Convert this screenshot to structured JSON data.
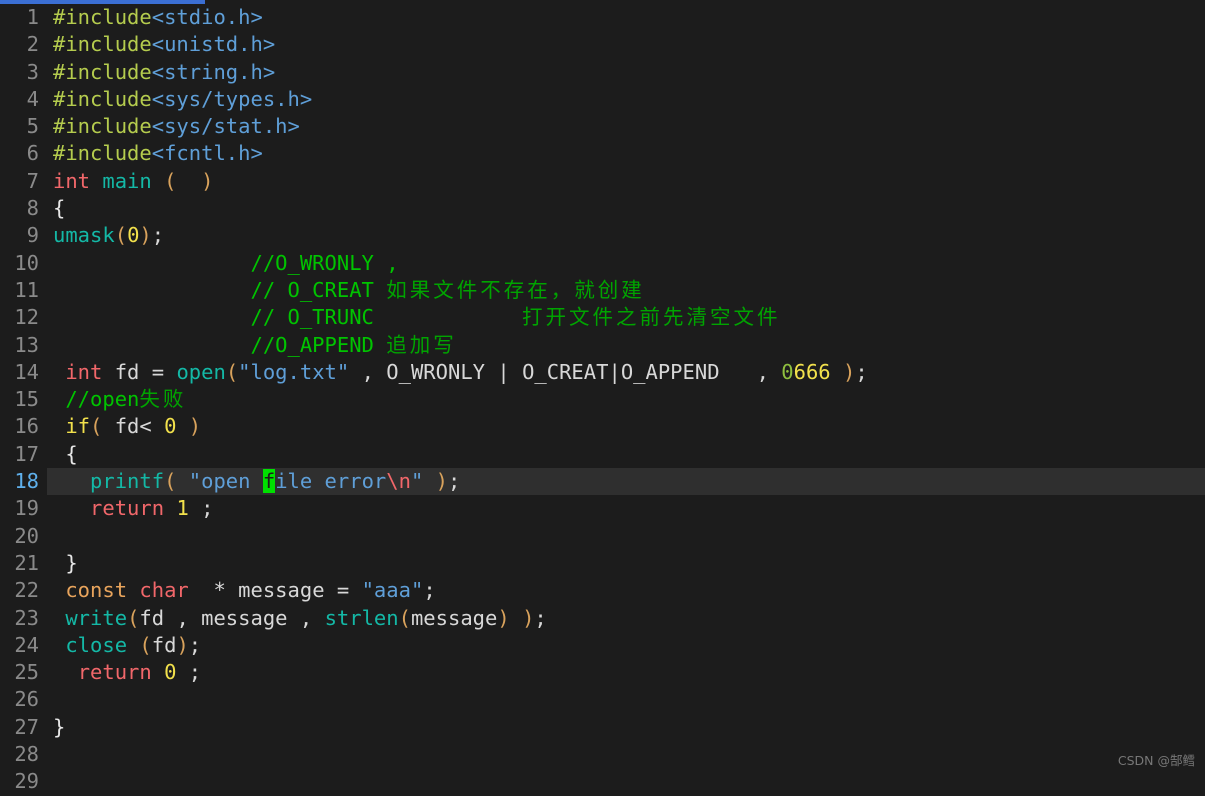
{
  "editor": {
    "background": "#1c1c1c",
    "current_line_background": "#2f2f2f",
    "gutter_color": "#8a8a8a",
    "current_line_number_color": "#5fb0ec",
    "cursor_color": "#00e000",
    "top_bar_color": "#3b6fd4",
    "current_line_number": 18,
    "first_line_number": 1,
    "last_line_number": 29
  },
  "watermark": {
    "text": "CSDN @郜鳕"
  },
  "lines": [
    {
      "n": "1",
      "text": "#include<stdio.h>"
    },
    {
      "n": "2",
      "text": "#include<unistd.h>"
    },
    {
      "n": "3",
      "text": "#include<string.h>"
    },
    {
      "n": "4",
      "text": "#include<sys/types.h>"
    },
    {
      "n": "5",
      "text": "#include<sys/stat.h>"
    },
    {
      "n": "6",
      "text": "#include<fcntl.h>"
    },
    {
      "n": "7",
      "text": "int main (  )"
    },
    {
      "n": "8",
      "text": "{"
    },
    {
      "n": "9",
      "text": "umask(0);"
    },
    {
      "n": "10",
      "text": "                //O_WRONLY ,"
    },
    {
      "n": "11",
      "text": "                // O_CREAT 如果文件不存在，就创建"
    },
    {
      "n": "12",
      "text": "                // O_TRUNC            打开文件之前先清空文件"
    },
    {
      "n": "13",
      "text": "                //O_APPEND 追加写"
    },
    {
      "n": "14",
      "text": " int fd = open(\"log.txt\" , O_WRONLY | O_CREAT|O_APPEND   , 0666 );"
    },
    {
      "n": "15",
      "text": " //open失败"
    },
    {
      "n": "16",
      "text": " if( fd< 0 )"
    },
    {
      "n": "17",
      "text": " {"
    },
    {
      "n": "18",
      "text": "   printf( \"open file error\\n\" );"
    },
    {
      "n": "19",
      "text": "   return 1 ;"
    },
    {
      "n": "20",
      "text": ""
    },
    {
      "n": "21",
      "text": " }"
    },
    {
      "n": "22",
      "text": " const char  * message = \"aaa\";"
    },
    {
      "n": "23",
      "text": " write(fd , message , strlen(message) );"
    },
    {
      "n": "24",
      "text": " close (fd);"
    },
    {
      "n": "25",
      "text": "  return 0 ;"
    },
    {
      "n": "26",
      "text": ""
    },
    {
      "n": "27",
      "text": "}"
    },
    {
      "n": "28",
      "text": ""
    },
    {
      "n": "29",
      "text": ""
    }
  ],
  "comments": {
    "line11_cjk": "如果文件不存在，就创建",
    "line12_cjk": "打开文件之前先清空文件",
    "line13_cjk": "追加写",
    "line15_cjk": "失败"
  }
}
